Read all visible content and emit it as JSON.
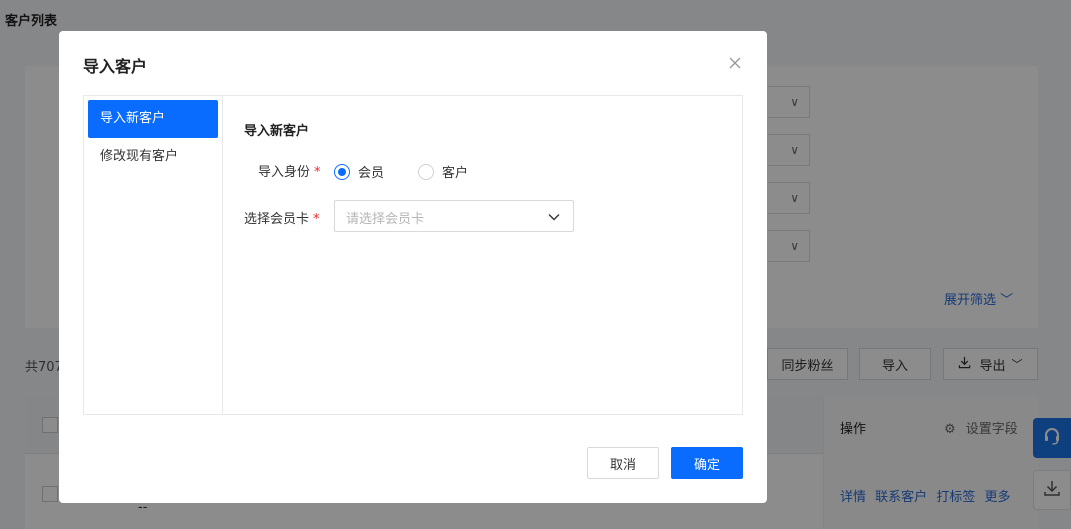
{
  "page": {
    "title": "客户列表",
    "expand_filter_label": "展开筛选",
    "count_text": "共707",
    "sync_fans_label": "同步粉丝",
    "import_label": "导入",
    "export_label": "导出",
    "table": {
      "op_header": "操作",
      "settings_label": "设置字段",
      "row_links": [
        "详情",
        "联系客户",
        "打标签",
        "更多"
      ],
      "dash": "--"
    }
  },
  "modal": {
    "title": "导入客户",
    "nav": [
      {
        "label": "导入新客户",
        "active": true
      },
      {
        "label": "修改现有客户",
        "active": false
      }
    ],
    "section_title": "导入新客户",
    "identity": {
      "label": "导入身份",
      "options": [
        {
          "label": "会员",
          "checked": true
        },
        {
          "label": "客户",
          "checked": false
        }
      ]
    },
    "member_card": {
      "label": "选择会员卡",
      "placeholder": "请选择会员卡"
    },
    "cancel_label": "取消",
    "confirm_label": "确定"
  },
  "colors": {
    "primary": "#0a6cff",
    "required": "#f5222d",
    "link": "#2a6bd7"
  }
}
